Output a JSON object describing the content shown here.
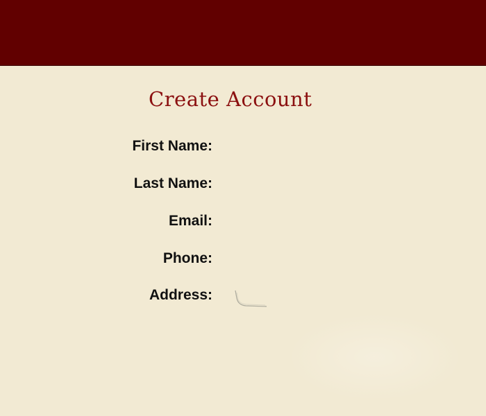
{
  "form": {
    "title": "Create Account",
    "fields": [
      {
        "label": "First Name:",
        "value": "",
        "placeholder": ""
      },
      {
        "label": "Last Name:",
        "value": "",
        "placeholder": ""
      },
      {
        "label": "Email:",
        "value": "",
        "placeholder": ""
      },
      {
        "label": "Phone:",
        "value": "",
        "placeholder": ""
      },
      {
        "label": "Address:",
        "value": "",
        "placeholder": ""
      }
    ]
  },
  "colors": {
    "header_bar": "#610000",
    "background": "#f2ead3",
    "title": "#8b1010",
    "label_text": "#111111"
  }
}
